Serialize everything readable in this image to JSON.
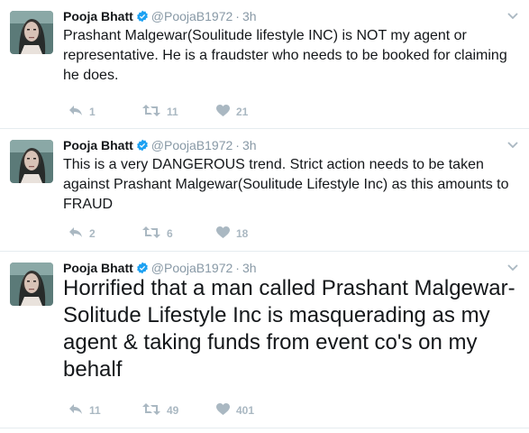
{
  "colors": {
    "verified": "#1da1f2",
    "muted": "#8899a6",
    "icon": "#aab8c2",
    "divider": "#e6ecf0"
  },
  "icons": {
    "reply": "reply-icon",
    "retweet": "retweet-icon",
    "like": "heart-icon",
    "verified": "verified-badge-icon",
    "menu": "chevron-down-icon"
  },
  "tweets": [
    {
      "name": "Pooja Bhatt",
      "handle": "@PoojaB1972",
      "separator": "·",
      "time": "3h",
      "text": "Prashant Malgewar(Soulitude lifestyle INC) is NOT my agent or representative. He is a fraudster who needs to be booked for claiming he does.",
      "replies": "1",
      "retweets": "11",
      "likes": "21"
    },
    {
      "name": "Pooja Bhatt",
      "handle": "@PoojaB1972",
      "separator": "·",
      "time": "3h",
      "text": "This is a very DANGEROUS trend. Strict action needs to be taken against Prashant Malgewar(Soulitude Lifestyle Inc) as this amounts to FRAUD",
      "replies": "2",
      "retweets": "6",
      "likes": "18"
    },
    {
      "name": "Pooja Bhatt",
      "handle": "@PoojaB1972",
      "separator": "·",
      "time": "3h",
      "text": "Horrified that a man called Prashant Malgewar-Solitude Lifestyle Inc is masquerading as my agent & taking funds from event co's on my behalf",
      "replies": "11",
      "retweets": "49",
      "likes": "401"
    }
  ]
}
